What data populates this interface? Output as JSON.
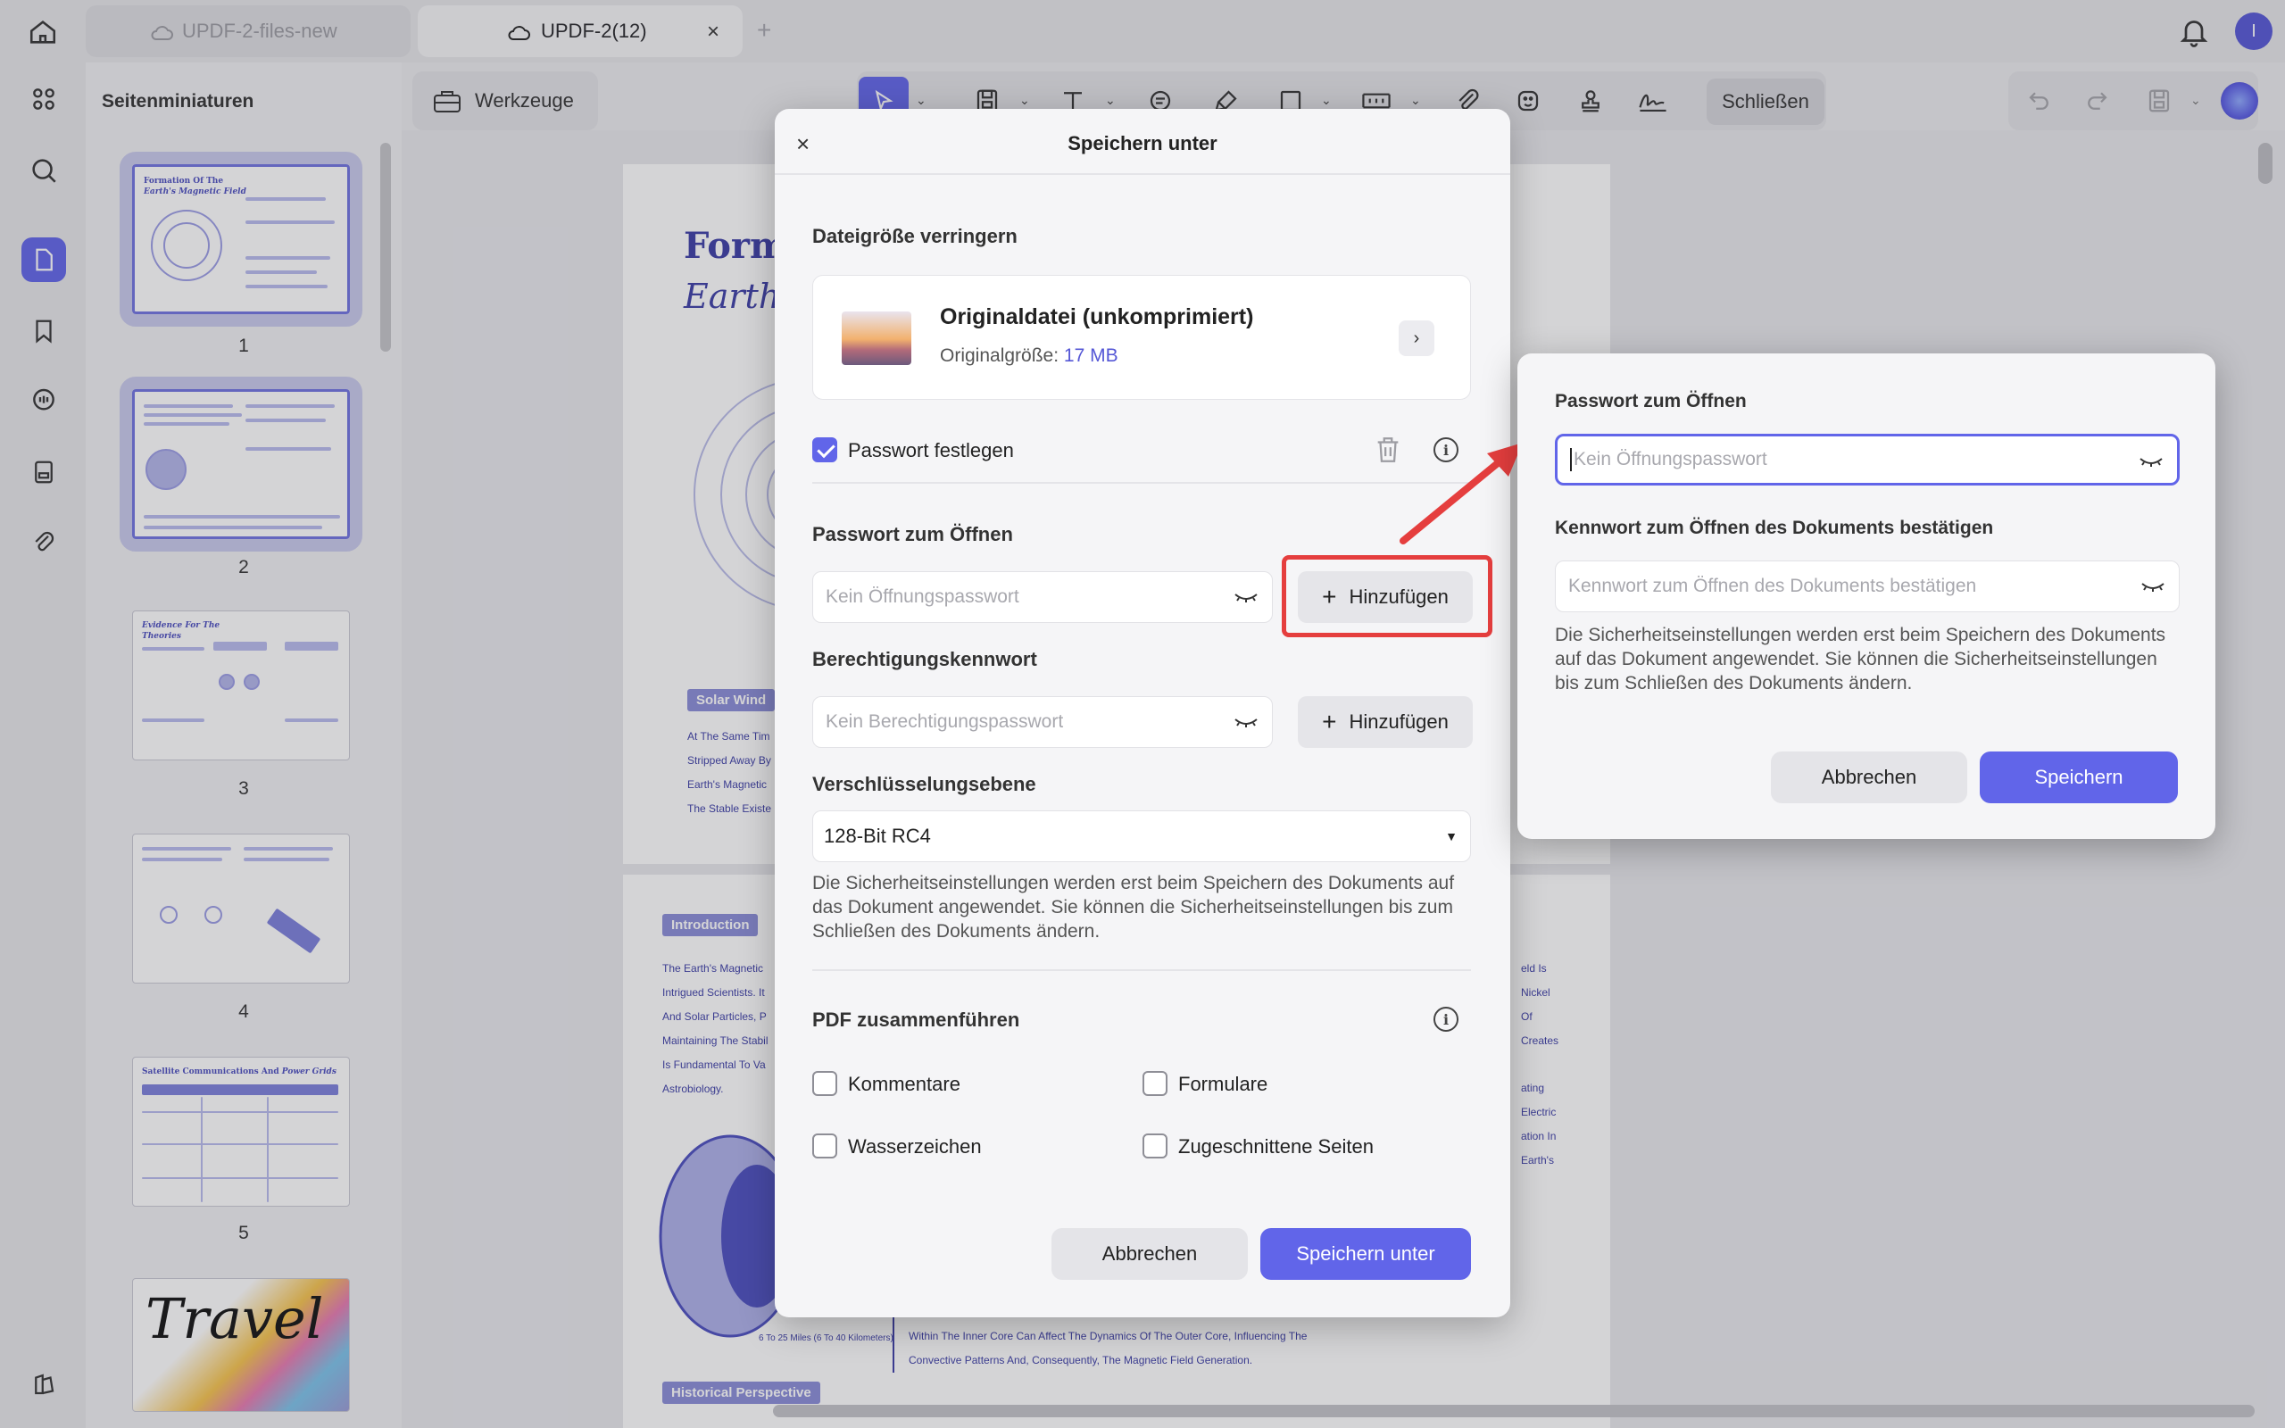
{
  "tabs": [
    {
      "label": "UPDF-2-files-new",
      "active": false
    },
    {
      "label": "UPDF-2(12)",
      "active": true,
      "close": "×"
    }
  ],
  "tab_add": "+",
  "avatar_initial": "I",
  "sidebar": {
    "title": "Seitenminiaturen",
    "pages": [
      "1",
      "2",
      "3",
      "4",
      "5"
    ]
  },
  "tools_button": "Werkzeuge",
  "toolbar": {
    "close_label": "Schließen"
  },
  "document": {
    "page1_title_a": "Form",
    "page1_title_b": "Earth'",
    "solar_wind_tag": "Solar Wind",
    "solar_lines": [
      "At The Same Tim",
      "Stripped Away By",
      "Earth's Magnetic",
      "The Stable Existe"
    ],
    "intro_tag": "Introduction",
    "intro_lines": [
      "The Earth's Magnetic",
      "Intrigued Scientists. It",
      "And Solar Particles, P",
      "Maintaining The Stabil",
      "Is Fundamental To Va",
      "Astrobiology."
    ],
    "right_lines": [
      "eld Is",
      "Nickel",
      "Of",
      "Creates",
      "ating",
      "Electric",
      "ation In",
      "Earth's"
    ],
    "bottom_lines": [
      "Within The Inner Core Can Affect The Dynamics Of The Outer Core, Influencing The",
      "Convective Patterns And, Consequently, The Magnetic Field Generation."
    ],
    "caption": "6 To 25 Miles (6 To 40 Kilometers)",
    "historical_tag": "Historical Perspective"
  },
  "save_dialog": {
    "close": "×",
    "title": "Speichern unter",
    "reduce_label": "Dateigröße verringern",
    "card_title": "Originaldatei (unkomprimiert)",
    "card_sub_prefix": "Originalgröße:",
    "card_size": "17 MB",
    "card_chevron": "›",
    "password_checkbox": "Passwort festlegen",
    "open_pw_label": "Passwort zum Öffnen",
    "open_pw_placeholder": "Kein Öffnungspasswort",
    "add_label": "Hinzufügen",
    "perm_label": "Berechtigungskennwort",
    "perm_placeholder": "Kein Berechtigungspasswort",
    "encryption_label": "Verschlüsselungsebene",
    "encryption_value": "128-Bit RC4",
    "note": "Die Sicherheitseinstellungen werden erst beim Speichern des Dokuments auf das Dokument angewendet. Sie können die Sicherheitseinstellungen bis zum Schließen des Dokuments ändern.",
    "merge_label": "PDF zusammenführen",
    "merge_options": [
      "Kommentare",
      "Formulare",
      "Wasserzeichen",
      "Zugeschnittene Seiten"
    ],
    "cancel": "Abbrechen",
    "save_as": "Speichern unter"
  },
  "password_popover": {
    "open_label": "Passwort zum Öffnen",
    "open_placeholder": "Kein Öffnungspasswort",
    "confirm_label": "Kennwort zum Öffnen des Dokuments bestätigen",
    "confirm_placeholder": "Kennwort zum Öffnen des Dokuments bestätigen",
    "note": "Die Sicherheitseinstellungen werden erst beim Speichern des Dokuments auf das Dokument angewendet. Sie können die Sicherheitseinstellungen bis zum Schließen des Dokuments ändern.",
    "cancel": "Abbrechen",
    "save": "Speichern"
  },
  "colors": {
    "accent": "#6165e9",
    "highlight": "#e53e3e"
  }
}
